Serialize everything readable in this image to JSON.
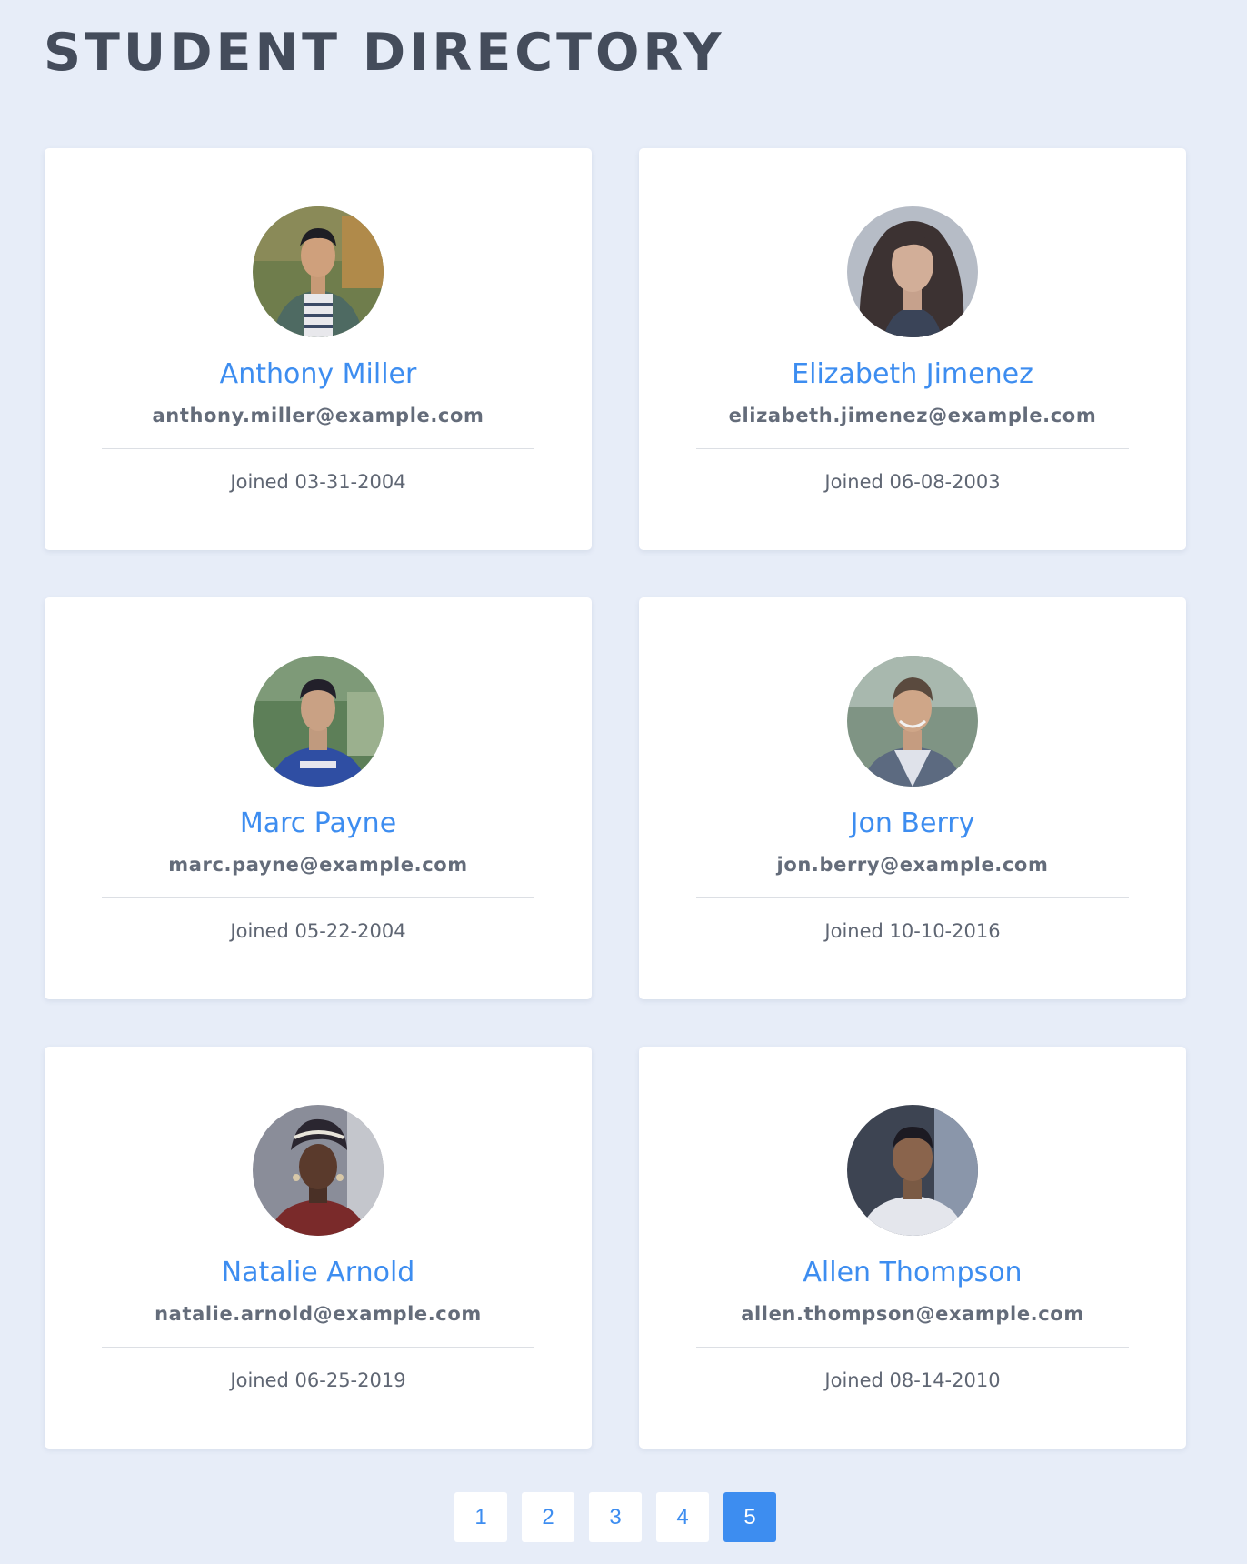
{
  "page": {
    "title": "STUDENT DIRECTORY"
  },
  "students": [
    {
      "name": "Anthony Miller",
      "email": "anthony.miller@example.com",
      "joined": "Joined 03-31-2004"
    },
    {
      "name": "Elizabeth Jimenez",
      "email": "elizabeth.jimenez@example.com",
      "joined": "Joined 06-08-2003"
    },
    {
      "name": "Marc Payne",
      "email": "marc.payne@example.com",
      "joined": "Joined 05-22-2004"
    },
    {
      "name": "Jon Berry",
      "email": "jon.berry@example.com",
      "joined": "Joined 10-10-2016"
    },
    {
      "name": "Natalie Arnold",
      "email": "natalie.arnold@example.com",
      "joined": "Joined 06-25-2019"
    },
    {
      "name": "Allen Thompson",
      "email": "allen.thompson@example.com",
      "joined": "Joined 08-14-2010"
    }
  ],
  "pagination": {
    "pages": [
      "1",
      "2",
      "3",
      "4",
      "5"
    ],
    "current": "5"
  },
  "colors": {
    "background": "#e7edf8",
    "accent": "#3d8df0",
    "title": "#444c5b",
    "card": "#ffffff"
  }
}
